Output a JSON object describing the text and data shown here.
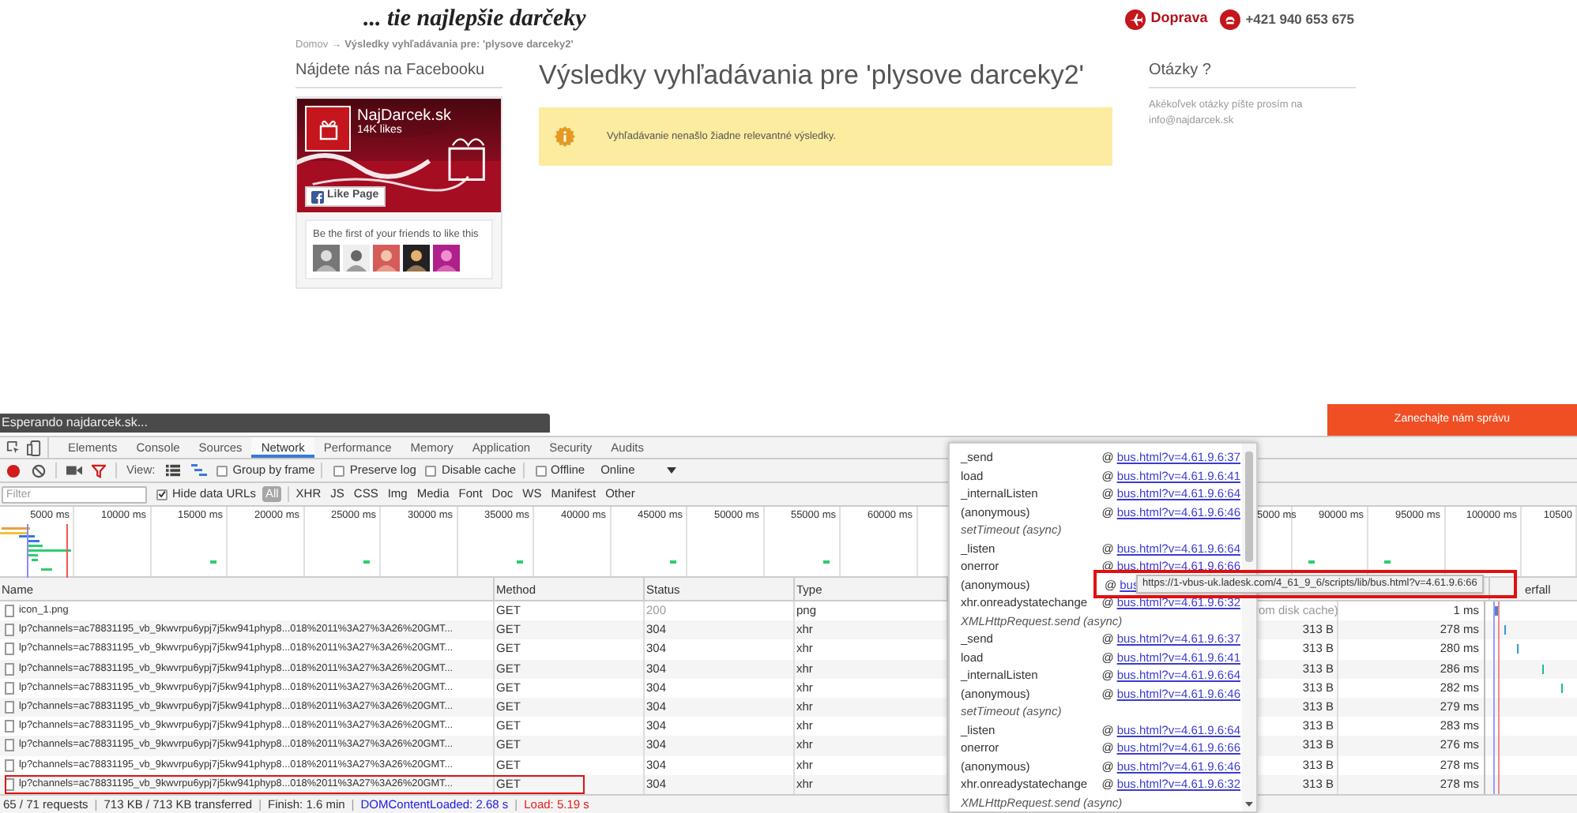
{
  "site": {
    "tagline": "... tie najlepšie darčeky",
    "contacts": [
      {
        "kind": "delivery",
        "label": "Doprava"
      },
      {
        "kind": "phone",
        "label": "+421 940 653 675"
      }
    ],
    "breadcrumb": {
      "home": "Domov",
      "arrow": "→",
      "current": "Výsledky vyhľadávania pre: 'plysove darceky2'"
    },
    "facebook": {
      "heading": "Nájdete nás na Facebooku",
      "page_name": "NajDarcek.sk",
      "likes": "14K likes",
      "like_button": "Like Page",
      "friends_text": "Be the first of your friends to like this"
    },
    "results": {
      "title": "Výsledky vyhľadávania pre 'plysove darceky2'",
      "notice": "Vyhľadávanie nenašlo žiadne relevantné výsledky."
    },
    "questions": {
      "heading": "Otázky ?",
      "text": "Akékoľvek otázky píšte prosím na info@najdarcek.sk"
    },
    "loading_status": "Esperando najdarcek.sk...",
    "chat_button": "Zanechajte nám správu"
  },
  "devtools": {
    "tabs": [
      {
        "label": "Elements",
        "selected": false
      },
      {
        "label": "Console",
        "selected": false
      },
      {
        "label": "Sources",
        "selected": false
      },
      {
        "label": "Network",
        "selected": true
      },
      {
        "label": "Performance",
        "selected": false
      },
      {
        "label": "Memory",
        "selected": false
      },
      {
        "label": "Application",
        "selected": false
      },
      {
        "label": "Security",
        "selected": false
      },
      {
        "label": "Audits",
        "selected": false
      }
    ],
    "toolbar": {
      "recording": true,
      "view_label": "View:",
      "options": [
        {
          "label": "Group by frame",
          "checked": false
        },
        {
          "label": "Preserve log",
          "checked": false
        },
        {
          "label": "Disable cache",
          "checked": false
        },
        {
          "label": "Offline",
          "checked": false
        }
      ],
      "throttling": "Online"
    },
    "filter": {
      "placeholder": "Filter",
      "hide_data_urls": {
        "label": "Hide data URLs",
        "checked": true
      },
      "types": [
        {
          "label": "All",
          "selected": true
        },
        {
          "label": "XHR",
          "selected": false
        },
        {
          "label": "JS",
          "selected": false
        },
        {
          "label": "CSS",
          "selected": false
        },
        {
          "label": "Img",
          "selected": false
        },
        {
          "label": "Media",
          "selected": false
        },
        {
          "label": "Font",
          "selected": false
        },
        {
          "label": "Doc",
          "selected": false
        },
        {
          "label": "WS",
          "selected": false
        },
        {
          "label": "Manifest",
          "selected": false
        },
        {
          "label": "Other",
          "selected": false
        }
      ]
    },
    "overview": {
      "left_ticks": [
        "5000 ms",
        "10000 ms",
        "15000 ms",
        "20000 ms",
        "25000 ms",
        "30000 ms",
        "35000 ms",
        "40000 ms",
        "45000 ms",
        "50000 ms",
        "55000 ms",
        "60000 ms"
      ],
      "right_ticks": [
        "5000 ms",
        "90000 ms",
        "95000 ms",
        "100000 ms",
        "10500"
      ]
    },
    "table": {
      "columns": [
        "Name",
        "Method",
        "Status",
        "Type",
        "erfall"
      ],
      "rows": [
        {
          "name": "icon_1.png",
          "method": "GET",
          "status": "200",
          "type": "png",
          "size": "rom disk cache)",
          "time": "1 ms",
          "from_cache": true,
          "annotated": false
        },
        {
          "name": "lp?channels=ac78831195_vb_9kwvrpu6ypj7j5kw941phyp8...018%2011%3A27%3A26%20GMT...",
          "method": "GET",
          "status": "304",
          "type": "xhr",
          "size": "313 B",
          "time": "278 ms",
          "from_cache": false,
          "annotated": false
        },
        {
          "name": "lp?channels=ac78831195_vb_9kwvrpu6ypj7j5kw941phyp8...018%2011%3A27%3A26%20GMT...",
          "method": "GET",
          "status": "304",
          "type": "xhr",
          "size": "313 B",
          "time": "280 ms",
          "from_cache": false,
          "annotated": false
        },
        {
          "name": "lp?channels=ac78831195_vb_9kwvrpu6ypj7j5kw941phyp8...018%2011%3A27%3A26%20GMT...",
          "method": "GET",
          "status": "304",
          "type": "xhr",
          "size": "313 B",
          "time": "286 ms",
          "from_cache": false,
          "annotated": false
        },
        {
          "name": "lp?channels=ac78831195_vb_9kwvrpu6ypj7j5kw941phyp8...018%2011%3A27%3A26%20GMT...",
          "method": "GET",
          "status": "304",
          "type": "xhr",
          "size": "313 B",
          "time": "282 ms",
          "from_cache": false,
          "annotated": false
        },
        {
          "name": "lp?channels=ac78831195_vb_9kwvrpu6ypj7j5kw941phyp8...018%2011%3A27%3A26%20GMT...",
          "method": "GET",
          "status": "304",
          "type": "xhr",
          "size": "313 B",
          "time": "279 ms",
          "from_cache": false,
          "annotated": false
        },
        {
          "name": "lp?channels=ac78831195_vb_9kwvrpu6ypj7j5kw941phyp8...018%2011%3A27%3A26%20GMT...",
          "method": "GET",
          "status": "304",
          "type": "xhr",
          "size": "313 B",
          "time": "283 ms",
          "from_cache": false,
          "annotated": false
        },
        {
          "name": "lp?channels=ac78831195_vb_9kwvrpu6ypj7j5kw941phyp8...018%2011%3A27%3A26%20GMT...",
          "method": "GET",
          "status": "304",
          "type": "xhr",
          "size": "313 B",
          "time": "276 ms",
          "from_cache": false,
          "annotated": false
        },
        {
          "name": "lp?channels=ac78831195_vb_9kwvrpu6ypj7j5kw941phyp8...018%2011%3A27%3A26%20GMT...",
          "method": "GET",
          "status": "304",
          "type": "xhr",
          "size": "313 B",
          "time": "278 ms",
          "from_cache": false,
          "annotated": false
        },
        {
          "name": "lp?channels=ac78831195_vb_9kwvrpu6ypj7j5kw941phyp8...018%2011%3A27%3A26%20GMT...",
          "method": "GET",
          "status": "304",
          "type": "xhr",
          "size": "313 B",
          "time": "278 ms",
          "from_cache": false,
          "annotated": true
        }
      ]
    },
    "status_bar": {
      "separator": "|",
      "items": [
        {
          "kind": "plain",
          "text": "65 / 71 requests"
        },
        {
          "kind": "plain",
          "text": "713 KB / 713 KB transferred"
        },
        {
          "kind": "plain",
          "text": "Finish: 1.6 min"
        },
        {
          "kind": "dom",
          "text": "DOMContentLoaded: 2.68 s"
        },
        {
          "kind": "load",
          "text": "Load: 5.19 s"
        }
      ]
    },
    "initiator_popup": {
      "at": "@",
      "frames": [
        {
          "kind": "call",
          "function": "_send",
          "link": "bus.html?v=4.61.9.6:37"
        },
        {
          "kind": "call",
          "function": "load",
          "link": "bus.html?v=4.61.9.6:41"
        },
        {
          "kind": "call",
          "function": "_internalListen",
          "link": "bus.html?v=4.61.9.6:64"
        },
        {
          "kind": "call",
          "function": "(anonymous)",
          "link": "bus.html?v=4.61.9.6:46"
        },
        {
          "kind": "async",
          "function": "setTimeout (async)"
        },
        {
          "kind": "call",
          "function": "_listen",
          "link": "bus.html?v=4.61.9.6:64"
        },
        {
          "kind": "call",
          "function": "onerror",
          "link": "bus.html?v=4.61.9.6:66"
        },
        {
          "kind": "call",
          "function": "(anonymous)",
          "link": "bus"
        },
        {
          "kind": "call",
          "function": "xhr.onreadystatechange",
          "link": "bus.html?v=4.61.9.6:32"
        },
        {
          "kind": "async",
          "function": "XMLHttpRequest.send (async)"
        },
        {
          "kind": "call",
          "function": "_send",
          "link": "bus.html?v=4.61.9.6:37"
        },
        {
          "kind": "call",
          "function": "load",
          "link": "bus.html?v=4.61.9.6:41"
        },
        {
          "kind": "call",
          "function": "_internalListen",
          "link": "bus.html?v=4.61.9.6:64"
        },
        {
          "kind": "call",
          "function": "(anonymous)",
          "link": "bus.html?v=4.61.9.6:46"
        },
        {
          "kind": "async",
          "function": "setTimeout (async)"
        },
        {
          "kind": "call",
          "function": "_listen",
          "link": "bus.html?v=4.61.9.6:64"
        },
        {
          "kind": "call",
          "function": "onerror",
          "link": "bus.html?v=4.61.9.6:66"
        },
        {
          "kind": "call",
          "function": "(anonymous)",
          "link": "bus.html?v=4.61.9.6:46"
        },
        {
          "kind": "call",
          "function": "xhr.onreadystatechange",
          "link": "bus.html?v=4.61.9.6:32"
        },
        {
          "kind": "async",
          "function": "XMLHttpRequest.send (async)"
        }
      ]
    },
    "tooltip": {
      "text": "https://1-vbus-uk.ladesk.com/4_61_9_6/scripts/lib/bus.html?v=4.61.9.6:66",
      "annotated": true
    }
  }
}
